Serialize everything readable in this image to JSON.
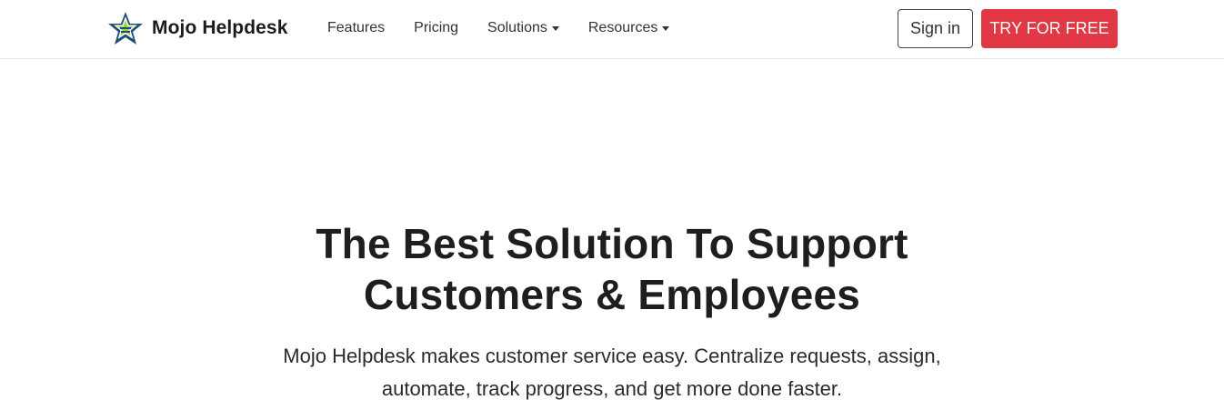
{
  "brand": {
    "name": "Mojo Helpdesk",
    "logo_icon": "star-logo-icon",
    "colors": {
      "star_fill": "#1f4e79",
      "accent": "#a7d13b"
    }
  },
  "nav": {
    "items": [
      {
        "label": "Features",
        "dropdown": false
      },
      {
        "label": "Pricing",
        "dropdown": false
      },
      {
        "label": "Solutions",
        "dropdown": true
      },
      {
        "label": "Resources",
        "dropdown": true
      }
    ]
  },
  "actions": {
    "signin_label": "Sign in",
    "try_label": "TRY FOR FREE",
    "try_color": "#e23744"
  },
  "hero": {
    "title_line1": "The Best Solution To Support",
    "title_line2": "Customers & Employees",
    "subtitle_line1": "Mojo Helpdesk makes customer service easy. Centralize requests, assign,",
    "subtitle_line2": "automate, track progress, and get more done faster."
  }
}
